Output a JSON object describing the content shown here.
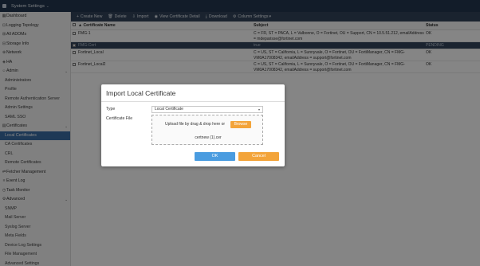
{
  "header": {
    "title": "System Settings"
  },
  "sidebar": {
    "items": [
      {
        "icon": "dashboard-icon",
        "glyph": "▦",
        "label": "Dashboard",
        "type": "top"
      },
      {
        "icon": "logging-topology-icon",
        "glyph": "⊡",
        "label": "Logging Topology",
        "type": "top"
      },
      {
        "icon": "adoms-icon",
        "glyph": "⊞",
        "label": "All ADOMs",
        "type": "top"
      },
      {
        "icon": "storage-icon",
        "glyph": "⊟",
        "label": "Storage Info",
        "type": "top"
      },
      {
        "icon": "network-icon",
        "glyph": "⊕",
        "label": "Network",
        "type": "top"
      },
      {
        "icon": "ha-icon",
        "glyph": "◈",
        "label": "HA",
        "type": "top"
      },
      {
        "icon": "admin-icon",
        "glyph": "☺",
        "label": "Admin",
        "type": "group"
      },
      {
        "label": "Administrators",
        "type": "sub"
      },
      {
        "label": "Profile",
        "type": "sub"
      },
      {
        "label": "Remote Authentication Server",
        "type": "sub"
      },
      {
        "label": "Admin Settings",
        "type": "sub"
      },
      {
        "label": "SAML SSO",
        "type": "sub"
      },
      {
        "icon": "certificates-icon",
        "glyph": "▤",
        "label": "Certificates",
        "type": "group"
      },
      {
        "label": "Local Certificates",
        "type": "sub",
        "active": true
      },
      {
        "label": "CA Certificates",
        "type": "sub"
      },
      {
        "label": "CRL",
        "type": "sub"
      },
      {
        "label": "Remote Certificates",
        "type": "sub"
      },
      {
        "icon": "fetcher-icon",
        "glyph": "⇄",
        "label": "Fetcher Management",
        "type": "top"
      },
      {
        "icon": "event-log-icon",
        "glyph": "≡",
        "label": "Event Log",
        "type": "top"
      },
      {
        "icon": "task-monitor-icon",
        "glyph": "◷",
        "label": "Task Monitor",
        "type": "top"
      },
      {
        "icon": "advanced-icon",
        "glyph": "⚙",
        "label": "Advanced",
        "type": "group"
      },
      {
        "label": "SNMP",
        "type": "sub"
      },
      {
        "label": "Mail Server",
        "type": "sub"
      },
      {
        "label": "Syslog Server",
        "type": "sub"
      },
      {
        "label": "Meta Fields",
        "type": "sub"
      },
      {
        "label": "Device Log Settings",
        "type": "sub"
      },
      {
        "label": "File Management",
        "type": "sub"
      },
      {
        "label": "Advanced Settings",
        "type": "sub"
      }
    ]
  },
  "toolbar": {
    "create": "Create New",
    "delete": "Delete",
    "import": "Import",
    "view": "View Certificate Detail",
    "download": "Download",
    "columns": "Column Settings"
  },
  "table": {
    "headers": {
      "name": "Certificate Name",
      "subject": "Subject",
      "status": "Status"
    },
    "rows": [
      {
        "name": "FMG-1",
        "subject": "C = FR, ST = PACA, L = Valbonne, O = Fortinet, OU = Support, CN = 10.5.51.212, emailAddress = mdeparisse@fortinet.com",
        "status": "OK",
        "selected": false
      },
      {
        "name": "FMG-Cert",
        "subject": "true",
        "status": "PENDING",
        "selected": true
      },
      {
        "name": "Fortinet_Local",
        "subject": "C = US, ST = California, L = Sunnyvale, O = Fortinet, OU = FortiManager, CN = FMG-VM0A17008342, emailAddress = support@fortinet.com",
        "status": "OK",
        "selected": false
      },
      {
        "name": "Fortinet_Local2",
        "subject": "C = US, ST = California, L = Sunnyvale, O = Fortinet, OU = FortiManager, CN = FMG-VM0A17008342, emailAddress = support@fortinet.com",
        "status": "OK",
        "selected": false
      }
    ]
  },
  "dialog": {
    "title": "Import Local Certificate",
    "type_label": "Type",
    "type_value": "Local Certificate",
    "file_label": "Certificate File",
    "dropzone_text": "Upload file by drag & drop here or",
    "browse": "Browse",
    "file_name": "certnew (1).cer",
    "ok": "OK",
    "cancel": "Cancel"
  }
}
